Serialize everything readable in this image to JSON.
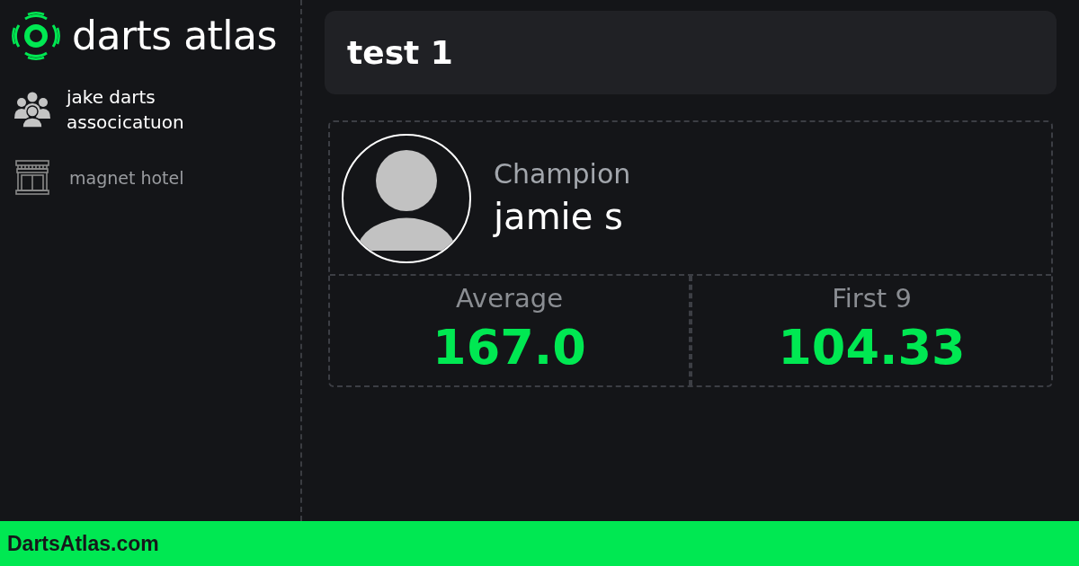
{
  "brand": {
    "name": "darts atlas"
  },
  "sidebar": {
    "items": [
      {
        "kind": "organization",
        "label": "jake darts associcatuon"
      },
      {
        "kind": "venue",
        "label": "magnet hotel"
      }
    ]
  },
  "event": {
    "title": "test 1"
  },
  "champion": {
    "label": "Champion",
    "name": "jamie s"
  },
  "stats": [
    {
      "label": "Average",
      "value": "167.0"
    },
    {
      "label": "First 9",
      "value": "104.33"
    }
  ],
  "footer": {
    "text": "DartsAtlas.com"
  }
}
